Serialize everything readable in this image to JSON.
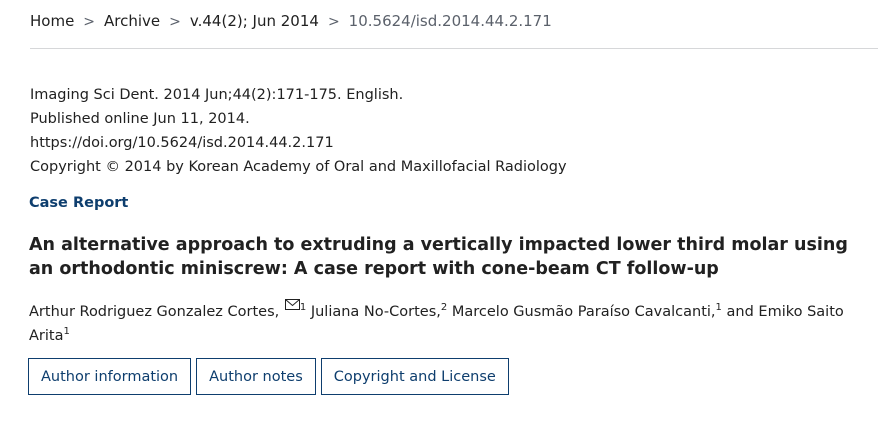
{
  "breadcrumb": {
    "home": "Home",
    "archive": "Archive",
    "issue": "v.44(2); Jun 2014",
    "doi": "10.5624/isd.2014.44.2.171",
    "separator": ">"
  },
  "citation": {
    "journal_line": "Imaging Sci Dent. 2014 Jun;44(2):171-175. English.",
    "published_line": "Published online Jun 11, 2014.",
    "doi_link": "https://doi.org/10.5624/isd.2014.44.2.171",
    "copyright_line": "Copyright © 2014 by Korean Academy of Oral and Maxillofacial Radiology"
  },
  "article": {
    "type": "Case Report",
    "title": "An alternative approach to extruding a vertically impacted lower third molar using an orthodontic miniscrew: A case report with cone-beam CT follow-up"
  },
  "authors": [
    {
      "name": "Arthur Rodriguez Gonzalez Cortes,",
      "aff": "1",
      "icon": "mail-icon"
    },
    {
      "name": "Juliana No-Cortes,",
      "aff": "2"
    },
    {
      "name": "Marcelo Gusmão Paraíso Cavalcanti,",
      "aff": "1"
    },
    {
      "connector": "and",
      "name": "Emiko Saito Arita",
      "aff": "1"
    }
  ],
  "buttons": {
    "author_information": "Author information",
    "author_notes": "Author notes",
    "copyright_license": "Copyright and License"
  },
  "colors": {
    "accent": "#0e3e6e",
    "text": "#212121",
    "muted": "#5b616b",
    "rule": "#d6d7d9"
  }
}
